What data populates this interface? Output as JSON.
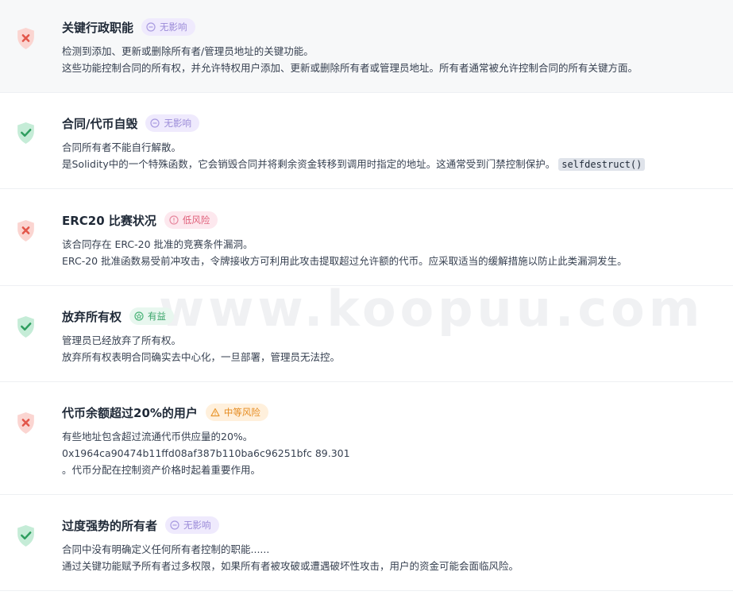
{
  "watermark": "www.koopuu.com",
  "items": [
    {
      "status": "fail",
      "title": "关键行政职能",
      "badge": {
        "label": "无影响",
        "level": "none"
      },
      "lines": [
        "检测到添加、更新或删除所有者/管理员地址的关键功能。",
        "这些功能控制合同的所有权，并允许特权用户添加、更新或删除所有者或管理员地址。所有者通常被允许控制合同的所有关键方面。"
      ]
    },
    {
      "status": "pass",
      "title": "合同/代币自毁",
      "badge": {
        "label": "无影响",
        "level": "none"
      },
      "lines": [
        "合同所有者不能自行解散。",
        "是Solidity中的一个特殊函数，它会销毁合同并将剩余资金转移到调用时指定的地址。这通常受到门禁控制保护。"
      ],
      "code": "selfdestruct()"
    },
    {
      "status": "fail",
      "title": "ERC20 比赛状况",
      "badge": {
        "label": "低风险",
        "level": "low"
      },
      "lines": [
        "该合同存在 ERC-20 批准的竞赛条件漏洞。",
        "ERC-20 批准函数易受前冲攻击，令牌接收方可利用此攻击提取超过允许额的代币。应采取适当的缓解措施以防止此类漏洞发生。"
      ]
    },
    {
      "status": "pass",
      "title": "放弃所有权",
      "badge": {
        "label": "有益",
        "level": "benefit"
      },
      "lines": [
        "管理员已经放弃了所有权。",
        "放弃所有权表明合同确实去中心化，一旦部署，管理员无法控。"
      ]
    },
    {
      "status": "fail",
      "title": "代币余额超过20%的用户",
      "badge": {
        "label": "中等风险",
        "level": "medium"
      },
      "lines": [
        "有些地址包含超过流通代币供应量的20%。",
        "0x1964ca90474b11ffd08af387b110ba6c96251bfc 89.301",
        "。代币分配在控制资产价格时起着重要作用。"
      ]
    },
    {
      "status": "pass",
      "title": "过度强势的所有者",
      "badge": {
        "label": "无影响",
        "level": "none"
      },
      "lines": [
        "合同中没有明确定义任何所有者控制的职能......",
        "通过关键功能赋予所有者过多权限，如果所有者被攻破或遭遇破坏性攻击，用户的资金可能会面临风险。"
      ]
    }
  ]
}
